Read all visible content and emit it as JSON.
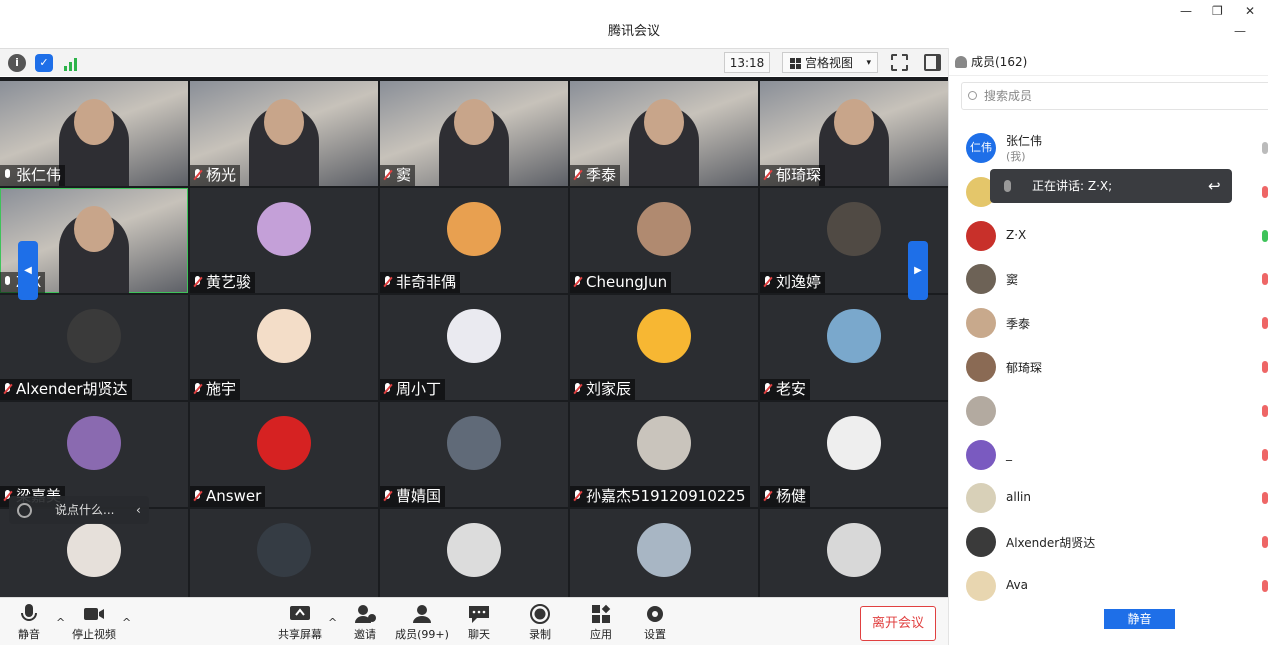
{
  "window": {
    "title": "腾讯会议",
    "min": "—",
    "restore": "❐",
    "close": "✕"
  },
  "toolbar": {
    "time": "13:18",
    "view_label": "宫格视图",
    "dropdown": "▾"
  },
  "tiles": [
    {
      "name": "张仁伟",
      "cam": true,
      "muted": false
    },
    {
      "name": "杨光",
      "cam": true,
      "muted": true
    },
    {
      "name": "窦",
      "cam": true,
      "muted": true
    },
    {
      "name": "季泰",
      "cam": true,
      "muted": true
    },
    {
      "name": "郁琦琛",
      "cam": true,
      "muted": true
    },
    {
      "name": "Z·X",
      "cam": true,
      "muted": false,
      "speaking": true
    },
    {
      "name": "黄艺骏",
      "avatar": "#c4a0d8",
      "muted": true
    },
    {
      "name": "非奇非偶",
      "avatar": "#e8a050",
      "muted": true
    },
    {
      "name": "CheungJun",
      "avatar": "#b08a70",
      "muted": true
    },
    {
      "name": "刘逸婷",
      "avatar": "#504a44",
      "muted": true
    },
    {
      "name": "Alxender胡贤达",
      "avatar": "#3a3a3a",
      "muted": true
    },
    {
      "name": "施宇",
      "avatar": "#f3ddc8",
      "muted": true
    },
    {
      "name": "周小丁",
      "avatar": "#eaeaf0",
      "muted": true
    },
    {
      "name": "刘家辰",
      "avatar": "#f7b733",
      "muted": true
    },
    {
      "name": "老安",
      "avatar": "#7aa8cc",
      "muted": true
    },
    {
      "name": "梁嘉美",
      "avatar": "#8a6ab0",
      "muted": true
    },
    {
      "name": "Answer",
      "avatar": "#d62222",
      "muted": true
    },
    {
      "name": "曹婧国",
      "avatar": "#606a78",
      "muted": true
    },
    {
      "name": "孙嘉杰519120910225",
      "avatar": "#c9c4bc",
      "muted": true
    },
    {
      "name": "杨健",
      "avatar": "#eeeeee",
      "muted": true
    },
    {
      "name": "",
      "avatar": "#e6e0da"
    },
    {
      "name": "",
      "avatar": "#353c44"
    },
    {
      "name": "",
      "avatar": "#dcdcdc"
    },
    {
      "name": "",
      "avatar": "#a8b6c4"
    },
    {
      "name": "",
      "avatar": "#d8d8d8"
    }
  ],
  "chat": {
    "placeholder": "说点什么...",
    "collapse": "‹"
  },
  "bottom": {
    "mute": "静音",
    "stop_video": "停止视频",
    "share": "共享屏幕",
    "invite": "邀请",
    "members": "成员(99+)",
    "chat": "聊天",
    "record": "录制",
    "apps": "应用",
    "settings": "设置",
    "leave": "离开会议",
    "chev": "^"
  },
  "panel": {
    "title": "成员(162)",
    "search_placeholder": "搜索成员",
    "me_initials": "仁伟",
    "me_note": "(我)",
    "members": [
      {
        "name": "张仁伟",
        "color": "#1e6fe8"
      },
      {
        "name": "",
        "color": "#e4c66a"
      },
      {
        "name": "Z·X",
        "color": "#c8302a"
      },
      {
        "name": "窦",
        "color": "#6d6256"
      },
      {
        "name": "季泰",
        "color": "#c8a98c"
      },
      {
        "name": "郁琦琛",
        "color": "#8a6a54"
      },
      {
        "name": "",
        "color": "#b3aaa0"
      },
      {
        "name": "_",
        "color": "#7a5ac0"
      },
      {
        "name": "allin",
        "color": "#d8d0b8"
      },
      {
        "name": "Alxender胡贤达",
        "color": "#3a3a3a"
      },
      {
        "name": "Ava",
        "color": "#e8d6b0"
      }
    ],
    "talking": "正在讲话: Z·X;",
    "mute_all": "静音"
  },
  "colors": {
    "accent": "#1e6fe8",
    "danger": "#e04040",
    "speaking": "#3ec35a"
  }
}
